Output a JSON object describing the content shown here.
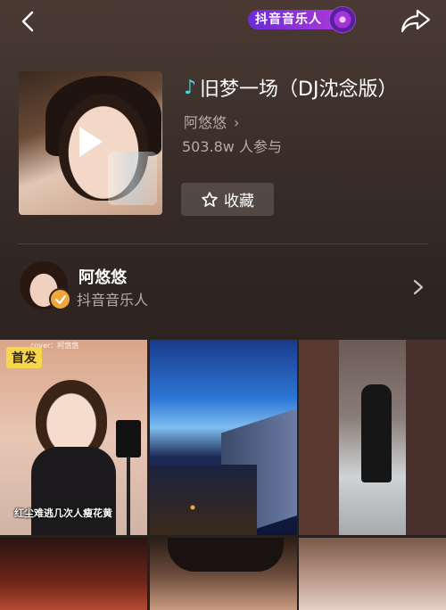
{
  "header": {
    "badge_label": "抖音音乐人"
  },
  "song": {
    "title": "旧梦一场（DJ沈念版）",
    "author": "阿悠悠",
    "participants": "503.8w 人参与",
    "favorite_label": "收藏"
  },
  "creator": {
    "name": "阿悠悠",
    "role": "抖音音乐人"
  },
  "videos": [
    {
      "tag": "首发",
      "overlay_top": "cover：阿悠悠",
      "caption": "红尘难逃几次人瘦花黄"
    },
    {},
    {},
    {},
    {},
    {}
  ],
  "colors": {
    "note_accent": "#4fd5e6",
    "badge_gradient_start": "#6b2bd8",
    "verified_badge": "#f2a63a",
    "first_tag": "#f6d64a"
  },
  "icons": [
    "back-icon",
    "share-icon",
    "music-note-icon",
    "play-icon",
    "star-icon",
    "chevron-right-icon",
    "check-icon"
  ]
}
